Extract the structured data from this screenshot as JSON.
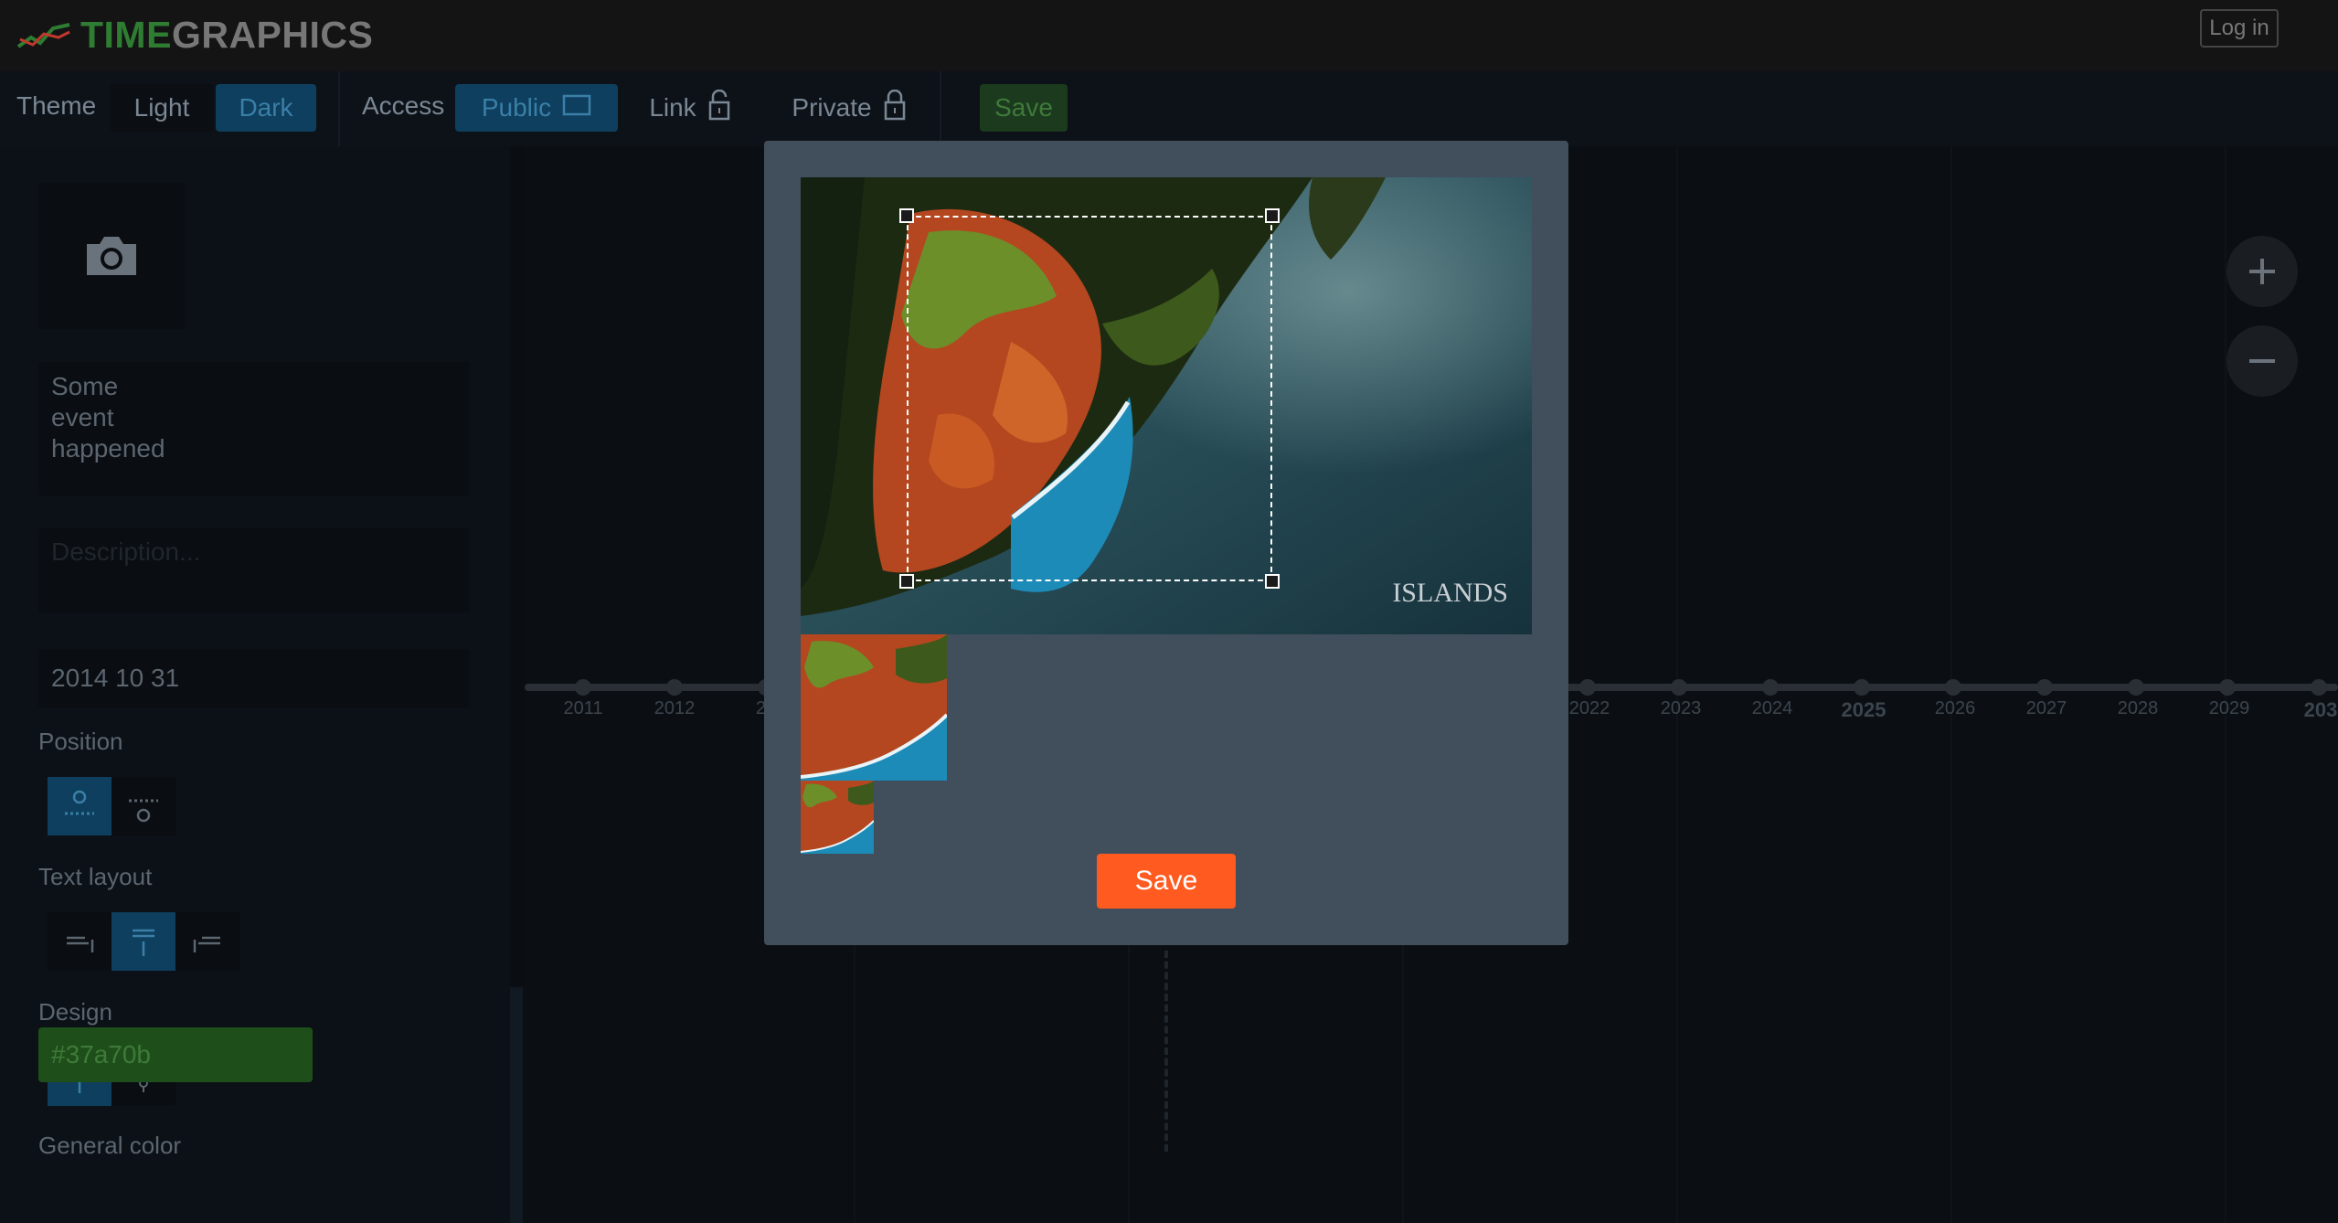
{
  "topbar": {
    "logo_part1": "TIME",
    "logo_part2": "GRAPHICS",
    "login_label": "Log in"
  },
  "toolbar": {
    "theme_label": "Theme",
    "theme_light": "Light",
    "theme_dark": "Dark",
    "theme_selected": "Dark",
    "access_label": "Access",
    "access_public": "Public",
    "access_link": "Link",
    "access_private": "Private",
    "access_selected": "Public",
    "save_label": "Save"
  },
  "editor": {
    "title_value": "Some event happened",
    "title_lines": [
      "Some",
      "event",
      "happened"
    ],
    "description_placeholder": "Description...",
    "date_value": "2014 10 31",
    "position_label": "Position",
    "text_layout_label": "Text layout",
    "design_label": "Design",
    "general_color_label": "General color",
    "general_color_value": "#37a70b"
  },
  "timeline": {
    "years_left": [
      "2011",
      "2012",
      "20"
    ],
    "years_right": [
      "2022",
      "2023",
      "2024",
      "2025",
      "2026",
      "2027",
      "2028",
      "2029",
      "203"
    ],
    "highlight_year": "2025"
  },
  "modal": {
    "watermark_text": "ISLANDS",
    "save_label": "Save"
  },
  "colors": {
    "accent_orange": "#ff5a1f",
    "brand_green": "#2e7d32",
    "active_blue": "#0f3f5e",
    "modal_bg": "#414e5c"
  },
  "icons": {
    "zoom_in": "plus-icon",
    "zoom_out": "minus-icon",
    "photo": "camera-icon",
    "public": "screen-icon",
    "link": "unlock-icon",
    "private": "lock-icon"
  }
}
